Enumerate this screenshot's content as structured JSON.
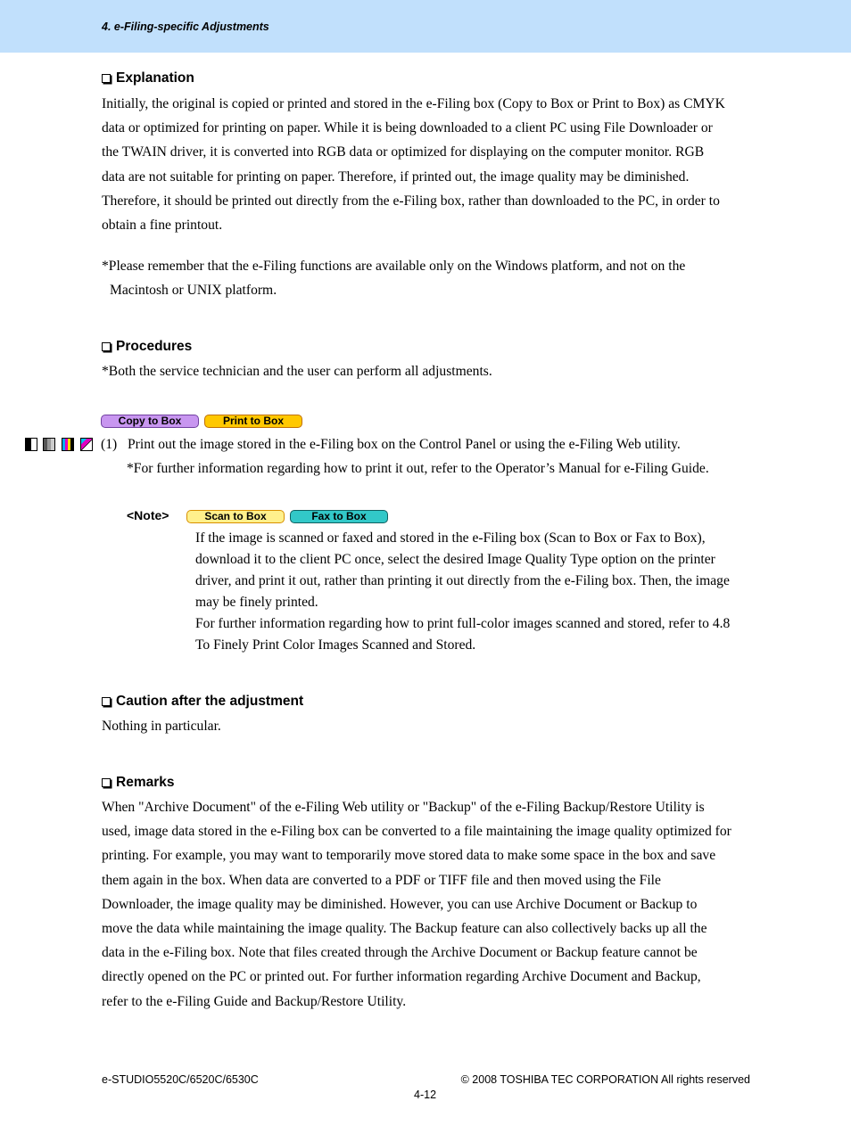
{
  "header": {
    "title": "4. e-Filing-specific Adjustments"
  },
  "sections": {
    "explanation": {
      "heading": "Explanation",
      "lines": [
        "Initially, the original is copied or printed and stored in the e-Filing box (Copy to Box or Print to Box) as CMYK",
        "data or optimized for printing on paper.  While it is being downloaded to a client PC using File Downloader or",
        "the TWAIN driver, it is converted into RGB data or optimized for displaying on the computer monitor.  RGB",
        "data are not suitable for printing on paper.  Therefore, if printed out, the image quality may be diminished.",
        "Therefore, it should be printed out directly from the e-Filing box, rather than downloaded to the PC, in order to",
        "obtain a fine printout."
      ],
      "note_line1": "Please remember that the e-Filing functions are available only on the Windows platform, and not on the",
      "note_line2": "Macintosh or UNIX platform."
    },
    "procedures": {
      "heading": "Procedures",
      "note": "Both the service technician and the user can perform all adjustments.",
      "tags": [
        "Copy to Box",
        "Print to Box"
      ],
      "step_number": "(1)",
      "step_text": "Print out the image stored in the e-Filing box on the Control Panel or using the e-Filing Web utility.",
      "step_note": "For further information regarding how to print it out, refer to the Operator’s Manual for e-Filing Guide.",
      "note_label": "<Note>",
      "note_tags": [
        "Scan to Box",
        "Fax to Box"
      ],
      "note_lines": [
        "If the image is scanned or faxed and stored in the e-Filing box (Scan to Box or Fax to Box),",
        "download it to the client PC once, select the desired Image Quality Type option on the printer",
        "driver, and print it out, rather than printing it out directly from the e-Filing box.  Then, the image",
        "may be finely printed.",
        "For further information regarding how to print full-color images scanned and stored, refer to 4.8",
        "To Finely Print Color Images Scanned and Stored."
      ]
    },
    "caution": {
      "heading": "Caution after the adjustment",
      "text": "Nothing in particular."
    },
    "remarks": {
      "heading": "Remarks",
      "lines": [
        "When \"Archive Document\" of the e-Filing Web utility or \"Backup\" of the e-Filing Backup/Restore Utility is",
        "used, image data stored in the e-Filing box can be converted to a file maintaining the image quality optimized for",
        "printing.  For example, you may want to temporarily move stored data to make some space in the box and save",
        "them again in the box.  When data are converted to a PDF or TIFF file and then moved using the File",
        "Downloader, the image quality may be diminished.  However, you can use Archive Document or Backup to",
        "move the data while maintaining the image quality.  The Backup feature can also collectively backs up all the",
        "data in the e-Filing box.  Note that files created through the Archive Document or Backup feature cannot be",
        "directly opened on the PC or printed out.  For further information regarding Archive Document and Backup,",
        "refer to the e-Filing Guide and Backup/Restore Utility."
      ]
    }
  },
  "asterisk": "*",
  "color_modes": [
    "black-white-mode-icon",
    "grayscale-mode-icon",
    "full-color-mode-icon",
    "twin-color-mode-icon"
  ],
  "tag_colors": {
    "copy_to_box": "#c896f0",
    "print_to_box": "#ffc800",
    "scan_to_box": "#fff08c",
    "fax_to_box": "#32c8c8"
  },
  "footer": {
    "model": "e-STUDIO5520C/6520C/6530C",
    "copyright": "© 2008 TOSHIBA TEC CORPORATION All rights reserved",
    "page": "4-12"
  }
}
